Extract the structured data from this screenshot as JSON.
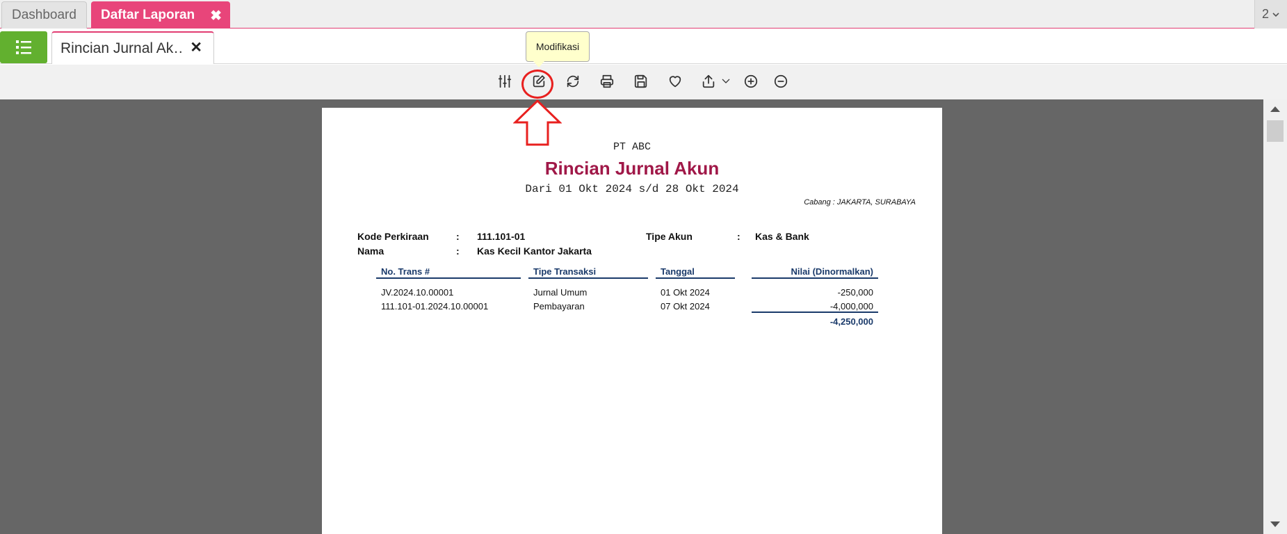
{
  "top_tabs": [
    {
      "label": "Dashboard",
      "active": false
    },
    {
      "label": "Daftar Laporan",
      "active": true
    }
  ],
  "tab_counter": "2",
  "document_tab": {
    "label": "Rincian Jurnal Ak…"
  },
  "tooltip": "Modifikasi",
  "toolbar_icons": [
    "sliders-icon",
    "edit-icon",
    "refresh-icon",
    "print-icon",
    "save-icon",
    "favorite-icon",
    "export-icon",
    "zoom-in-icon",
    "zoom-out-icon"
  ],
  "colors": {
    "accent": "#e8457a",
    "menu_green": "#62b02f",
    "title": "#a01848",
    "header": "#1a3a6a",
    "annotation": "#e8201f"
  },
  "report": {
    "company": "PT ABC",
    "title": "Rincian Jurnal Akun",
    "period": "Dari 01 Okt 2024 s/d 28 Okt 2024",
    "branch": "Cabang : JAKARTA, SURABAYA",
    "account_code_label": "Kode Perkiraan",
    "account_code": "111.101-01",
    "name_label": "Nama",
    "name": "Kas Kecil Kantor Jakarta",
    "account_type_label": "Tipe Akun",
    "account_type": "Kas & Bank",
    "separator": ":",
    "columns": [
      "No. Trans #",
      "Tipe Transaksi",
      "Tanggal",
      "Nilai (Dinormalkan)"
    ],
    "rows": [
      {
        "trans_no": "JV.2024.10.00001",
        "type": "Jurnal Umum",
        "date": "01 Okt 2024",
        "value": "-250,000"
      },
      {
        "trans_no": "111.101-01.2024.10.00001",
        "type": "Pembayaran",
        "date": "07 Okt 2024",
        "value": "-4,000,000"
      }
    ],
    "total": "-4,250,000"
  }
}
